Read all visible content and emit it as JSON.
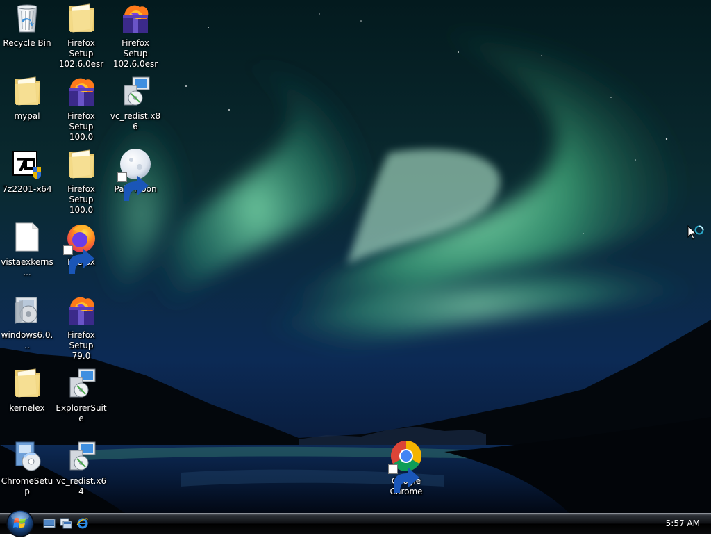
{
  "desktop": {
    "icons": [
      {
        "name": "recycle-bin",
        "label": "Recycle Bin",
        "icon": "recycle-bin-icon",
        "shortcut": false
      },
      {
        "name": "folder-firefox-setup-102",
        "label": "Firefox Setup\n102.6.0esr",
        "icon": "folder-icon",
        "shortcut": false
      },
      {
        "name": "firefox-setup-102-installer",
        "label": "Firefox Setup\n102.6.0esr",
        "icon": "firefox-installer-icon",
        "shortcut": false
      },
      {
        "name": "folder-mypal",
        "label": "mypal",
        "icon": "folder-icon",
        "shortcut": false
      },
      {
        "name": "firefox-setup-100-installer",
        "label": "Firefox Setup\n100.0",
        "icon": "firefox-installer-icon",
        "shortcut": false
      },
      {
        "name": "vc-redist-x86",
        "label": "vc_redist.x86",
        "icon": "installer-icon",
        "shortcut": false
      },
      {
        "name": "7z2201-x64",
        "label": "7z2201-x64",
        "icon": "7zip-icon",
        "shortcut": false
      },
      {
        "name": "folder-firefox-setup-100",
        "label": "Firefox Setup\n100.0",
        "icon": "folder-icon",
        "shortcut": false
      },
      {
        "name": "pale-moon",
        "label": "Pale Moon",
        "icon": "pale-moon-icon",
        "shortcut": true
      },
      {
        "name": "vistaexkernel-file",
        "label": "vistaexkerns...",
        "icon": "blank-file-icon",
        "shortcut": false
      },
      {
        "name": "firefox",
        "label": "Firefox",
        "icon": "firefox-icon",
        "shortcut": true
      },
      {
        "name": "windows6-update",
        "label": "windows6.0...",
        "icon": "windows-update-icon",
        "shortcut": false
      },
      {
        "name": "firefox-setup-79-installer",
        "label": "Firefox Setup\n79.0",
        "icon": "firefox-installer-icon",
        "shortcut": false
      },
      {
        "name": "folder-kernelex",
        "label": "kernelex",
        "icon": "folder-icon",
        "shortcut": false
      },
      {
        "name": "explorersuite",
        "label": "ExplorerSuite",
        "icon": "installer-icon",
        "shortcut": false
      },
      {
        "name": "chromesetup",
        "label": "ChromeSetup",
        "icon": "setup-cd-icon",
        "shortcut": false
      },
      {
        "name": "vc-redist-x64",
        "label": "vc_redist.x64",
        "icon": "installer-icon",
        "shortcut": false
      },
      {
        "name": "google-chrome",
        "label": "Google\nChrome",
        "icon": "chrome-icon",
        "shortcut": true
      }
    ]
  },
  "taskbar": {
    "start_icon": "windows-start-orb-icon",
    "quick_launch": [
      {
        "name": "show-desktop",
        "icon": "show-desktop-icon"
      },
      {
        "name": "switch-windows",
        "icon": "switch-windows-icon"
      },
      {
        "name": "internet-explorer",
        "icon": "internet-explorer-icon"
      }
    ],
    "clock": "5:57 AM"
  },
  "colors": {
    "aurora_green": "#5fd39a",
    "sky_dark": "#050d1e",
    "taskbar": "#0d0f12",
    "label_text": "#ffffff"
  }
}
